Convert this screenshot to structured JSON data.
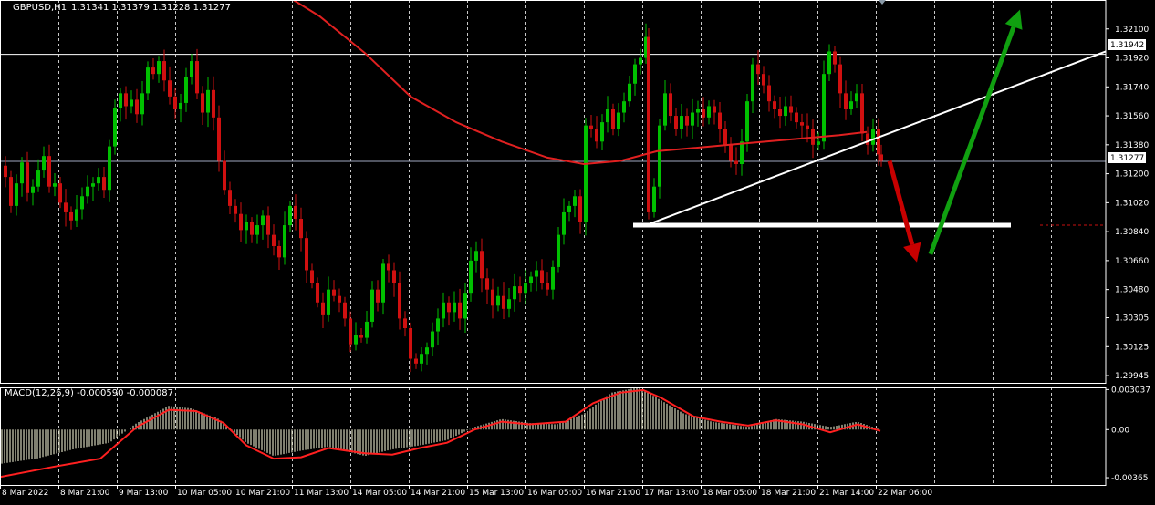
{
  "header": {
    "symbol": "GBPUSD,H1",
    "ohlc": "1.31341 1.31379 1.31228 1.31277"
  },
  "macd_header": {
    "label": "MACD(12,26,9) -0.000590 -0.000087"
  },
  "price_badges": {
    "resistance": "1.31942",
    "current": "1.31277"
  },
  "colors": {
    "background": "#000000",
    "bull_candle": "#00c000",
    "bear_candle": "#d01010",
    "moving_average": "#e02020",
    "macd_signal": "#ff2020",
    "macd_histogram": "#ffffe0",
    "trendline": "#ffffff",
    "arrow_down": "#c80000",
    "arrow_up": "#10a010"
  },
  "chart_data": [
    {
      "type": "candlestick",
      "title": "GBPUSD,H1",
      "ylim": [
        1.299,
        1.3228
      ],
      "y_ticks": [
        "1.32100",
        "1.31920",
        "1.31740",
        "1.31560",
        "1.31380",
        "1.31200",
        "1.31020",
        "1.30840",
        "1.30660",
        "1.30480",
        "1.30305",
        "1.30125",
        "1.29945"
      ],
      "x_ticks": [
        "8 Mar 2022",
        "8 Mar 21:00",
        "9 Mar 13:00",
        "10 Mar 05:00",
        "10 Mar 21:00",
        "11 Mar 13:00",
        "14 Mar 05:00",
        "14 Mar 21:00",
        "15 Mar 13:00",
        "16 Mar 05:00",
        "16 Mar 21:00",
        "17 Mar 13:00",
        "18 Mar 05:00",
        "18 Mar 21:00",
        "21 Mar 14:00",
        "22 Mar 06:00"
      ],
      "grid": true,
      "close_path": [
        [
          0,
          1.3125
        ],
        [
          6,
          1.3118
        ],
        [
          12,
          1.31
        ],
        [
          18,
          1.3114
        ],
        [
          24,
          1.3127
        ],
        [
          30,
          1.3108
        ],
        [
          36,
          1.3112
        ],
        [
          42,
          1.3122
        ],
        [
          48,
          1.3131
        ],
        [
          54,
          1.3112
        ],
        [
          60,
          1.3114
        ],
        [
          66,
          1.3102
        ],
        [
          72,
          1.3096
        ],
        [
          78,
          1.3091
        ],
        [
          84,
          1.3098
        ],
        [
          90,
          1.3106
        ],
        [
          96,
          1.3112
        ],
        [
          102,
          1.3114
        ],
        [
          108,
          1.3118
        ],
        [
          114,
          1.311
        ],
        [
          120,
          1.3137
        ],
        [
          126,
          1.3161
        ],
        [
          132,
          1.317
        ],
        [
          138,
          1.3162
        ],
        [
          144,
          1.3166
        ],
        [
          150,
          1.3157
        ],
        [
          156,
          1.317
        ],
        [
          162,
          1.3186
        ],
        [
          168,
          1.3182
        ],
        [
          174,
          1.319
        ],
        [
          180,
          1.3178
        ],
        [
          186,
          1.3168
        ],
        [
          192,
          1.316
        ],
        [
          198,
          1.3164
        ],
        [
          204,
          1.318
        ],
        [
          210,
          1.319
        ],
        [
          216,
          1.317
        ],
        [
          222,
          1.3158
        ],
        [
          228,
          1.3172
        ],
        [
          234,
          1.3155
        ],
        [
          240,
          1.3128
        ],
        [
          246,
          1.311
        ],
        [
          252,
          1.31
        ],
        [
          258,
          1.3095
        ],
        [
          264,
          1.3085
        ],
        [
          270,
          1.309
        ],
        [
          276,
          1.3082
        ],
        [
          282,
          1.3088
        ],
        [
          288,
          1.3094
        ],
        [
          294,
          1.3082
        ],
        [
          300,
          1.3075
        ],
        [
          306,
          1.3068
        ],
        [
          312,
          1.3088
        ],
        [
          318,
          1.31
        ],
        [
          324,
          1.3092
        ],
        [
          330,
          1.308
        ],
        [
          336,
          1.306
        ],
        [
          342,
          1.3052
        ],
        [
          348,
          1.304
        ],
        [
          354,
          1.3032
        ],
        [
          360,
          1.3048
        ],
        [
          366,
          1.3044
        ],
        [
          372,
          1.304
        ],
        [
          378,
          1.303
        ],
        [
          384,
          1.3014
        ],
        [
          390,
          1.302
        ],
        [
          396,
          1.3018
        ],
        [
          402,
          1.3028
        ],
        [
          408,
          1.3048
        ],
        [
          414,
          1.304
        ],
        [
          420,
          1.3064
        ],
        [
          426,
          1.306
        ],
        [
          432,
          1.3052
        ],
        [
          438,
          1.303
        ],
        [
          444,
          1.3024
        ],
        [
          450,
          1.3005
        ],
        [
          456,
          1.3002
        ],
        [
          462,
          1.3008
        ],
        [
          468,
          1.3012
        ],
        [
          474,
          1.3022
        ],
        [
          480,
          1.303
        ],
        [
          486,
          1.304
        ],
        [
          492,
          1.3034
        ],
        [
          498,
          1.304
        ],
        [
          504,
          1.303
        ],
        [
          510,
          1.3046
        ],
        [
          516,
          1.3066
        ],
        [
          522,
          1.3072
        ],
        [
          528,
          1.3055
        ],
        [
          534,
          1.3048
        ],
        [
          540,
          1.3038
        ],
        [
          546,
          1.3044
        ],
        [
          552,
          1.3036
        ],
        [
          558,
          1.3042
        ],
        [
          564,
          1.305
        ],
        [
          570,
          1.3046
        ],
        [
          576,
          1.3052
        ],
        [
          582,
          1.3056
        ],
        [
          588,
          1.306
        ],
        [
          594,
          1.3052
        ],
        [
          600,
          1.3048
        ],
        [
          606,
          1.3062
        ],
        [
          612,
          1.3082
        ],
        [
          618,
          1.3096
        ],
        [
          624,
          1.31
        ],
        [
          630,
          1.3106
        ],
        [
          636,
          1.309
        ],
        [
          642,
          1.315
        ],
        [
          648,
          1.3148
        ],
        [
          654,
          1.314
        ],
        [
          660,
          1.3152
        ],
        [
          666,
          1.316
        ],
        [
          672,
          1.3148
        ],
        [
          678,
          1.3158
        ],
        [
          684,
          1.3165
        ],
        [
          690,
          1.3176
        ],
        [
          696,
          1.3188
        ],
        [
          702,
          1.3192
        ],
        [
          708,
          1.3205
        ],
        [
          711,
          1.3096
        ],
        [
          717,
          1.3112
        ],
        [
          723,
          1.315
        ],
        [
          729,
          1.317
        ],
        [
          735,
          1.3156
        ],
        [
          741,
          1.3148
        ],
        [
          747,
          1.3156
        ],
        [
          753,
          1.315
        ],
        [
          759,
          1.3158
        ],
        [
          765,
          1.316
        ],
        [
          771,
          1.3155
        ],
        [
          777,
          1.3162
        ],
        [
          783,
          1.3158
        ],
        [
          789,
          1.3148
        ],
        [
          795,
          1.3138
        ],
        [
          801,
          1.3128
        ],
        [
          807,
          1.3126
        ],
        [
          813,
          1.314
        ],
        [
          819,
          1.3165
        ],
        [
          825,
          1.3188
        ],
        [
          831,
          1.3182
        ],
        [
          837,
          1.3175
        ],
        [
          843,
          1.3165
        ],
        [
          849,
          1.316
        ],
        [
          855,
          1.3156
        ],
        [
          861,
          1.3162
        ],
        [
          867,
          1.3158
        ],
        [
          873,
          1.3152
        ],
        [
          879,
          1.315
        ],
        [
          885,
          1.3148
        ],
        [
          891,
          1.3138
        ],
        [
          897,
          1.314
        ],
        [
          903,
          1.3182
        ],
        [
          909,
          1.3196
        ],
        [
          915,
          1.3188
        ],
        [
          921,
          1.317
        ],
        [
          927,
          1.316
        ],
        [
          933,
          1.3165
        ],
        [
          939,
          1.317
        ],
        [
          945,
          1.3145
        ],
        [
          951,
          1.3138
        ],
        [
          957,
          1.3148
        ],
        [
          963,
          1.3132
        ],
        [
          966,
          1.3128
        ]
      ],
      "moving_average": [
        [
          310,
          1.3232
        ],
        [
          350,
          1.3218
        ],
        [
          400,
          1.3195
        ],
        [
          450,
          1.3168
        ],
        [
          500,
          1.3152
        ],
        [
          550,
          1.314
        ],
        [
          600,
          1.313
        ],
        [
          640,
          1.3126
        ],
        [
          680,
          1.3128
        ],
        [
          720,
          1.3134
        ],
        [
          760,
          1.3136
        ],
        [
          800,
          1.3138
        ],
        [
          840,
          1.314
        ],
        [
          880,
          1.3142
        ],
        [
          920,
          1.3144
        ],
        [
          950,
          1.3146
        ]
      ],
      "horizontal_lines": [
        1.31942,
        1.31277
      ],
      "drawn_objects": {
        "support_level": 1.3088,
        "support_start": 694,
        "support_end": 1108,
        "trendline_from": [
          708,
          1.3088
        ],
        "trendline_to": [
          1212,
          1.3196
        ],
        "target_line": 1.3088,
        "arrow_down_from": [
          975,
          1.3128
        ],
        "arrow_down_to": [
          1005,
          1.3065
        ],
        "arrow_up_from": [
          1020,
          1.307
        ],
        "arrow_up_to": [
          1118,
          1.3222
        ]
      }
    },
    {
      "type": "bar",
      "title": "MACD(12,26,9) -0.000590 -0.000087",
      "ylim": [
        -0.0042,
        0.0032
      ],
      "y_ticks": [
        "0.003037",
        "0.00",
        "-0.00365"
      ],
      "macd_path": [
        [
          0,
          -0.0026
        ],
        [
          40,
          -0.0022
        ],
        [
          80,
          -0.0015
        ],
        [
          120,
          -0.001
        ],
        [
          150,
          0.0005
        ],
        [
          185,
          0.0018
        ],
        [
          210,
          0.0016
        ],
        [
          240,
          0.0008
        ],
        [
          270,
          -0.001
        ],
        [
          300,
          -0.002
        ],
        [
          330,
          -0.0016
        ],
        [
          360,
          -0.0013
        ],
        [
          400,
          -0.002
        ],
        [
          430,
          -0.0015
        ],
        [
          460,
          -0.0012
        ],
        [
          490,
          -0.0008
        ],
        [
          520,
          0.0002
        ],
        [
          550,
          0.0008
        ],
        [
          580,
          0.0005
        ],
        [
          610,
          0.0004
        ],
        [
          640,
          0.0012
        ],
        [
          670,
          0.0028
        ],
        [
          700,
          0.0032
        ],
        [
          720,
          0.0024
        ],
        [
          750,
          0.0012
        ],
        [
          780,
          0.0006
        ],
        [
          800,
          0.0004
        ],
        [
          820,
          0.0002
        ],
        [
          850,
          0.0008
        ],
        [
          880,
          0.0006
        ],
        [
          910,
          0.0002
        ],
        [
          940,
          0.0006
        ],
        [
          965,
          0.0
        ]
      ],
      "signal_path": [
        [
          0,
          -0.0036
        ],
        [
          60,
          -0.0028
        ],
        [
          110,
          -0.0022
        ],
        [
          150,
          0.0002
        ],
        [
          185,
          0.0015
        ],
        [
          215,
          0.0014
        ],
        [
          245,
          0.0005
        ],
        [
          270,
          -0.0012
        ],
        [
          300,
          -0.0022
        ],
        [
          330,
          -0.0021
        ],
        [
          360,
          -0.0014
        ],
        [
          400,
          -0.0018
        ],
        [
          430,
          -0.0019
        ],
        [
          460,
          -0.0014
        ],
        [
          490,
          -0.001
        ],
        [
          520,
          0.0
        ],
        [
          550,
          0.0006
        ],
        [
          580,
          0.0004
        ],
        [
          620,
          0.0006
        ],
        [
          650,
          0.002
        ],
        [
          680,
          0.0028
        ],
        [
          705,
          0.003
        ],
        [
          725,
          0.0024
        ],
        [
          760,
          0.001
        ],
        [
          790,
          0.0006
        ],
        [
          820,
          0.0003
        ],
        [
          850,
          0.0007
        ],
        [
          880,
          0.0004
        ],
        [
          910,
          -0.0002
        ],
        [
          940,
          0.0004
        ],
        [
          965,
          -0.0001
        ]
      ]
    }
  ]
}
